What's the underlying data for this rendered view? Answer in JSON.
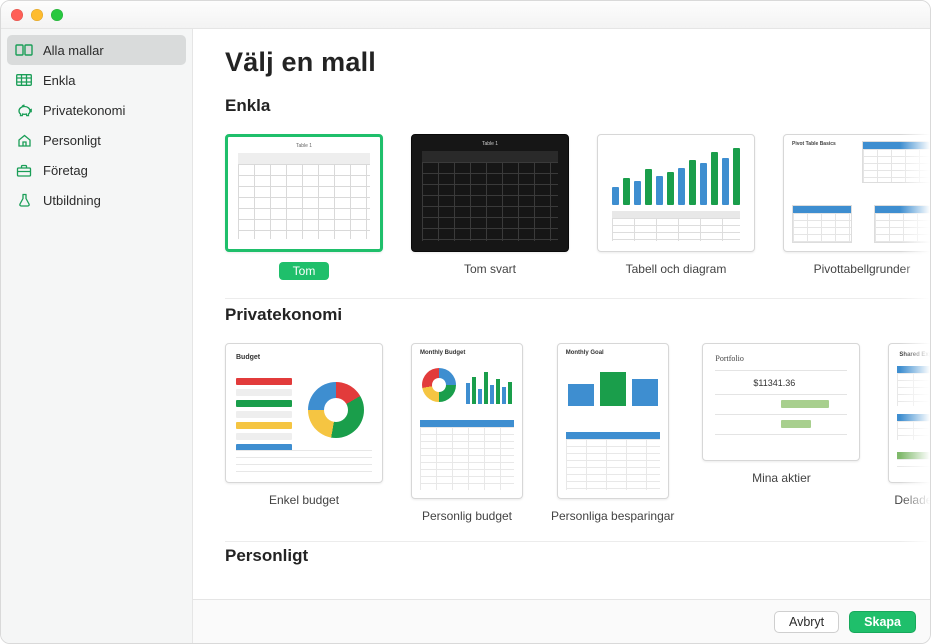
{
  "sidebar": {
    "items": [
      {
        "label": "Alla mallar",
        "icon": "all"
      },
      {
        "label": "Enkla",
        "icon": "grid"
      },
      {
        "label": "Privatekonomi",
        "icon": "piggy"
      },
      {
        "label": "Personligt",
        "icon": "home"
      },
      {
        "label": "Företag",
        "icon": "briefcase"
      },
      {
        "label": "Utbildning",
        "icon": "flask"
      }
    ]
  },
  "page_title": "Välj en mall",
  "sections": {
    "enkla": {
      "title": "Enkla",
      "cards": [
        {
          "label": "Tom"
        },
        {
          "label": "Tom svart"
        },
        {
          "label": "Tabell och diagram"
        },
        {
          "label": "Pivottabellgrunder"
        }
      ]
    },
    "privatekonomi": {
      "title": "Privatekonomi",
      "cards": [
        {
          "label": "Enkel budget"
        },
        {
          "label": "Personlig budget"
        },
        {
          "label": "Personliga besparingar"
        },
        {
          "label": "Mina aktier"
        },
        {
          "label": "Delade utgifter"
        }
      ]
    },
    "personligt": {
      "title": "Personligt"
    }
  },
  "thumb_text": {
    "table1": "Table 1",
    "pivot_basics": "Pivot Table Basics",
    "budget": "Budget",
    "monthly_budget": "Monthly Budget",
    "monthly_goal": "Monthly Goal",
    "portfolio": "Portfolio",
    "portfolio_amount": "$11341.36",
    "shared_expenses": "Shared Expenses"
  },
  "footer": {
    "cancel": "Avbryt",
    "create": "Skapa"
  },
  "colors": {
    "accent": "#1fbf6b",
    "blue": "#3e8ed0",
    "green": "#1a9e4b",
    "yellow": "#f5c542",
    "red": "#e23b3b"
  }
}
